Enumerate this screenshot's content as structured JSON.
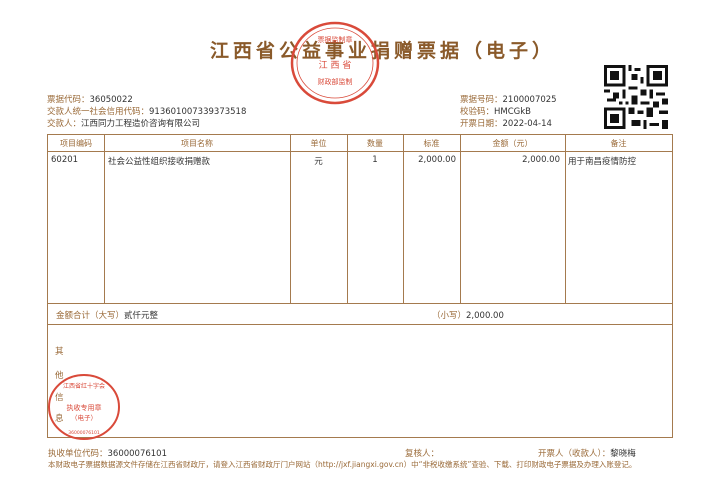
{
  "title": "江西省公益事业捐赠票据（电子）",
  "left_meta": [
    {
      "label": "票据代码：",
      "value": "36050022"
    },
    {
      "label": "交款人统一社会信用代码：",
      "value": "913601007339373518"
    },
    {
      "label": "交款人：",
      "value": "江西同力工程造价咨询有限公司"
    }
  ],
  "right_meta": [
    {
      "label": "票据号码：",
      "value": "2100007025"
    },
    {
      "label": "校验码：",
      "value": "HMCGkB"
    },
    {
      "label": "开票日期：",
      "value": "2022-04-14"
    }
  ],
  "table": {
    "headers": [
      "项目编码",
      "项目名称",
      "单位",
      "数量",
      "标准",
      "金额（元）",
      "备注"
    ],
    "rows": [
      {
        "code": "60201",
        "name": "社会公益性组织接收捐赠款",
        "unit": "元",
        "qty": "1",
        "standard": "2,000.00",
        "amount": "2,000.00",
        "note": "用于南昌疫情防控"
      }
    ]
  },
  "total": {
    "capital_label": "金额合计（大写）",
    "capital_value": "贰仟元整",
    "small_label": "（小写）",
    "small_value": "2,000.00"
  },
  "other_label": [
    "其",
    "他",
    "信",
    "息"
  ],
  "bottom": {
    "unit_code_label": "执收单位代码：",
    "unit_code_value": "36000076101",
    "reviewer_label": "复核人：",
    "issuer_label": "开票人（收款人）：",
    "issuer_value": "黎晓梅"
  },
  "footer_note": "本财政电子票据数据源文件存储在江西省财政厅，请登入江西省财政厅门户网站（http://jxf.jiangxi.gov.cn）中“非税收缴系统”查验、下载、打印财政电子票据及办理入账登记。",
  "seal_top": {
    "ring_text": "江西省财政部门票据监制章",
    "center_line1": "江 西 省",
    "center_line2": "财政部监制"
  },
  "seal_bottom": {
    "ring_text": "江西省红十字会",
    "center_line1": "执收专用章",
    "center_line2": "（电子）",
    "bottom_code": "36000076101"
  },
  "colors": {
    "frame": "#a47a4e",
    "label": "#9a6a38",
    "seal": "#d94a3a"
  }
}
